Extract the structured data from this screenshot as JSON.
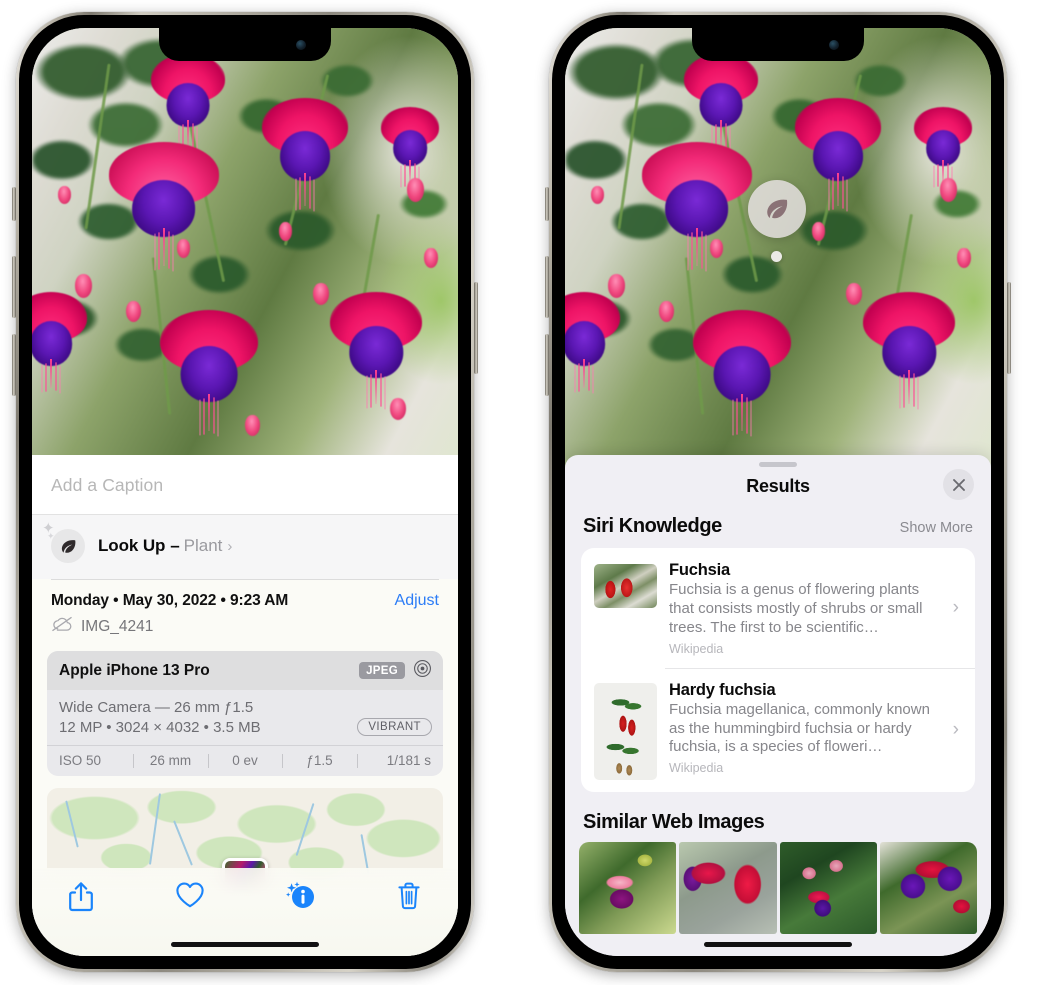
{
  "left_phone": {
    "caption": {
      "placeholder": "Add a Caption",
      "value": ""
    },
    "look_up": {
      "icon": "leaf-icon",
      "title": "Look Up",
      "separator": "–",
      "subject": "Plant",
      "chevron": "›"
    },
    "metadata": {
      "date_line": "Monday • May 30, 2022 • 9:23 AM",
      "adjust_label": "Adjust",
      "cloud_icon": "cloud-slash-icon",
      "file_name": "IMG_4241"
    },
    "exif": {
      "device": "Apple iPhone 13 Pro",
      "format_badge": "JPEG",
      "raw_icon": "aperture-icon",
      "lens_line": "Wide Camera — 26 mm ƒ1.5",
      "size_line": "12 MP • 3024 × 4032 • 3.5 MB",
      "style_badge": "VIBRANT",
      "stats": [
        "ISO 50",
        "26 mm",
        "0 ev",
        "ƒ1.5",
        "1/181 s"
      ]
    },
    "toolbar": [
      {
        "name": "share-button",
        "icon": "share-icon"
      },
      {
        "name": "favorite-button",
        "icon": "heart-icon"
      },
      {
        "name": "info-button",
        "icon": "info-sparkle-icon"
      },
      {
        "name": "delete-button",
        "icon": "trash-icon"
      }
    ],
    "accent_color": "#2b7cf6"
  },
  "right_phone": {
    "visual_lookup_badge": {
      "icon": "leaf-icon"
    },
    "sheet": {
      "title": "Results",
      "close_icon": "close-icon",
      "siri_knowledge": {
        "heading": "Siri Knowledge",
        "action": "Show More",
        "items": [
          {
            "title": "Fuchsia",
            "description": "Fuchsia is a genus of flowering plants that consists mostly of shrubs or small trees. The first to be scientific…",
            "source": "Wikipedia",
            "chevron": "›",
            "thumb": "fuchsia-red-flowers-thumb"
          },
          {
            "title": "Hardy fuchsia",
            "description": "Fuchsia magellanica, commonly known as the hummingbird fuchsia or hardy fuchsia, is a species of floweri…",
            "source": "Wikipedia",
            "chevron": "›",
            "thumb": "hardy-fuchsia-specimen-thumb"
          }
        ]
      },
      "similar_web_images": {
        "heading": "Similar Web Images",
        "items": [
          {
            "name": "similar-image-1"
          },
          {
            "name": "similar-image-2"
          },
          {
            "name": "similar-image-3"
          },
          {
            "name": "similar-image-4"
          }
        ]
      }
    }
  }
}
